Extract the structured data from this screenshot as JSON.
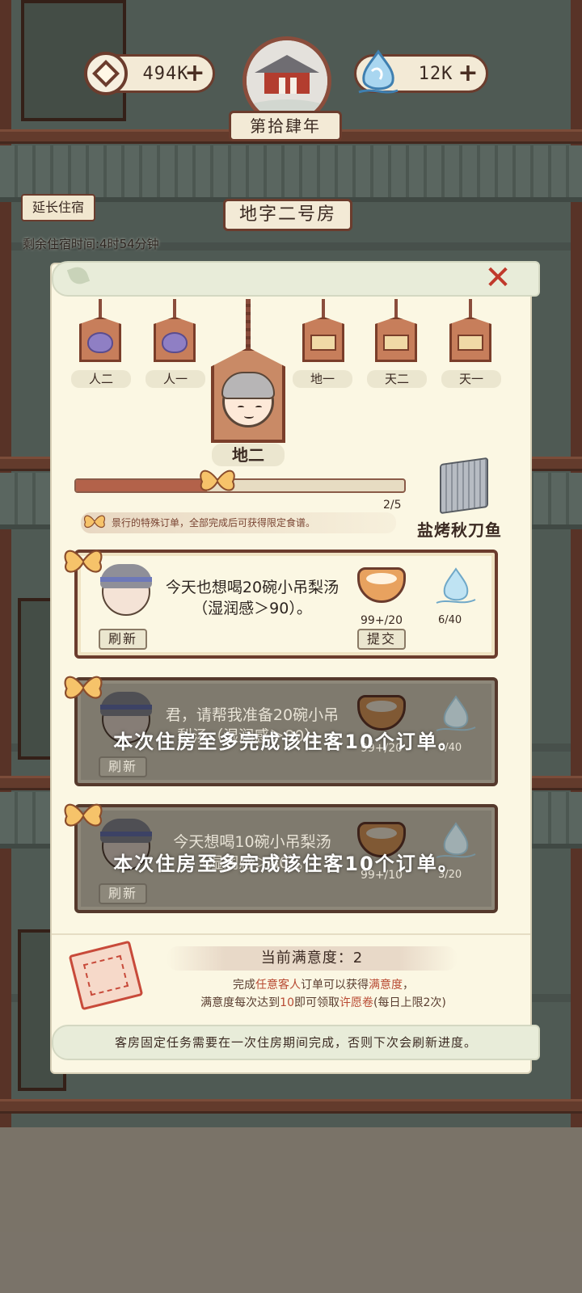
{
  "hud": {
    "coins": "494K",
    "spirit": "12K",
    "year": "第拾肆年",
    "plus_symbol": "+"
  },
  "room": {
    "extend_label": "延长住宿",
    "title": "地字二号房",
    "remaining_time": "剩余住宿时间:4时54分钟"
  },
  "guest_tags": [
    {
      "label": "人二",
      "icon": "purple-bag-icon"
    },
    {
      "label": "人一",
      "icon": "purple-bag-icon"
    },
    {
      "label": "地一",
      "icon": "drawer-box-icon"
    },
    {
      "label": "天二",
      "icon": "drawer-box-icon"
    },
    {
      "label": "天一",
      "icon": "drawer-box-icon"
    }
  ],
  "selected_guest": {
    "label": "地二",
    "icon": "smiling-face-icon"
  },
  "progress": {
    "current": 2,
    "total": 5,
    "fraction": 0.4,
    "text": "2/5",
    "note": "景行的特殊订单，全部完成后可获得限定食谱。",
    "reward": "盐烤秋刀鱼"
  },
  "orders": [
    {
      "text": "今天也想喝20碗小吊梨汤（湿润感＞90）。",
      "bowl_count": "99+/20",
      "spirit_count": "6/40",
      "refresh_label": "刷新",
      "submit_label": "提交",
      "disabled": false
    },
    {
      "text": "君，请帮我准备20碗小吊梨汤（湿润感＞80）。",
      "bowl_count": "99+/20",
      "spirit_count": "6/40",
      "refresh_label": "刷新",
      "disabled": true,
      "overlay": "本次住房至多完成该住客10个订单。"
    },
    {
      "text": "今天想喝10碗小吊梨汤（湿润感＞80）。",
      "bowl_count": "99+/10",
      "spirit_count": "3/20",
      "refresh_label": "刷新",
      "disabled": true,
      "overlay": "本次住房至多完成该住客10个订单。"
    }
  ],
  "satisfaction": {
    "title": "当前满意度：2",
    "line1_pre": "完成",
    "line1_hl": "任意客人",
    "line1_mid": "订单可以获得",
    "line1_hl2": "满意度",
    "line1_post": "，",
    "line2_pre": "满意度每次达到",
    "line2_hl": "10",
    "line2_mid": "即可领取",
    "line2_hl2": "许愿卷",
    "line2_post": "(每日上限2次)"
  },
  "footer_note": "客房固定任务需要在一次住房期间完成，否则下次会刷新进度。",
  "colors": {
    "accent_brown": "#6b3c2d",
    "highlight_red": "#b84a32",
    "panel_cream": "#fbf7e3",
    "progress_fill": "#b3624a",
    "close_red": "#c0392b"
  }
}
